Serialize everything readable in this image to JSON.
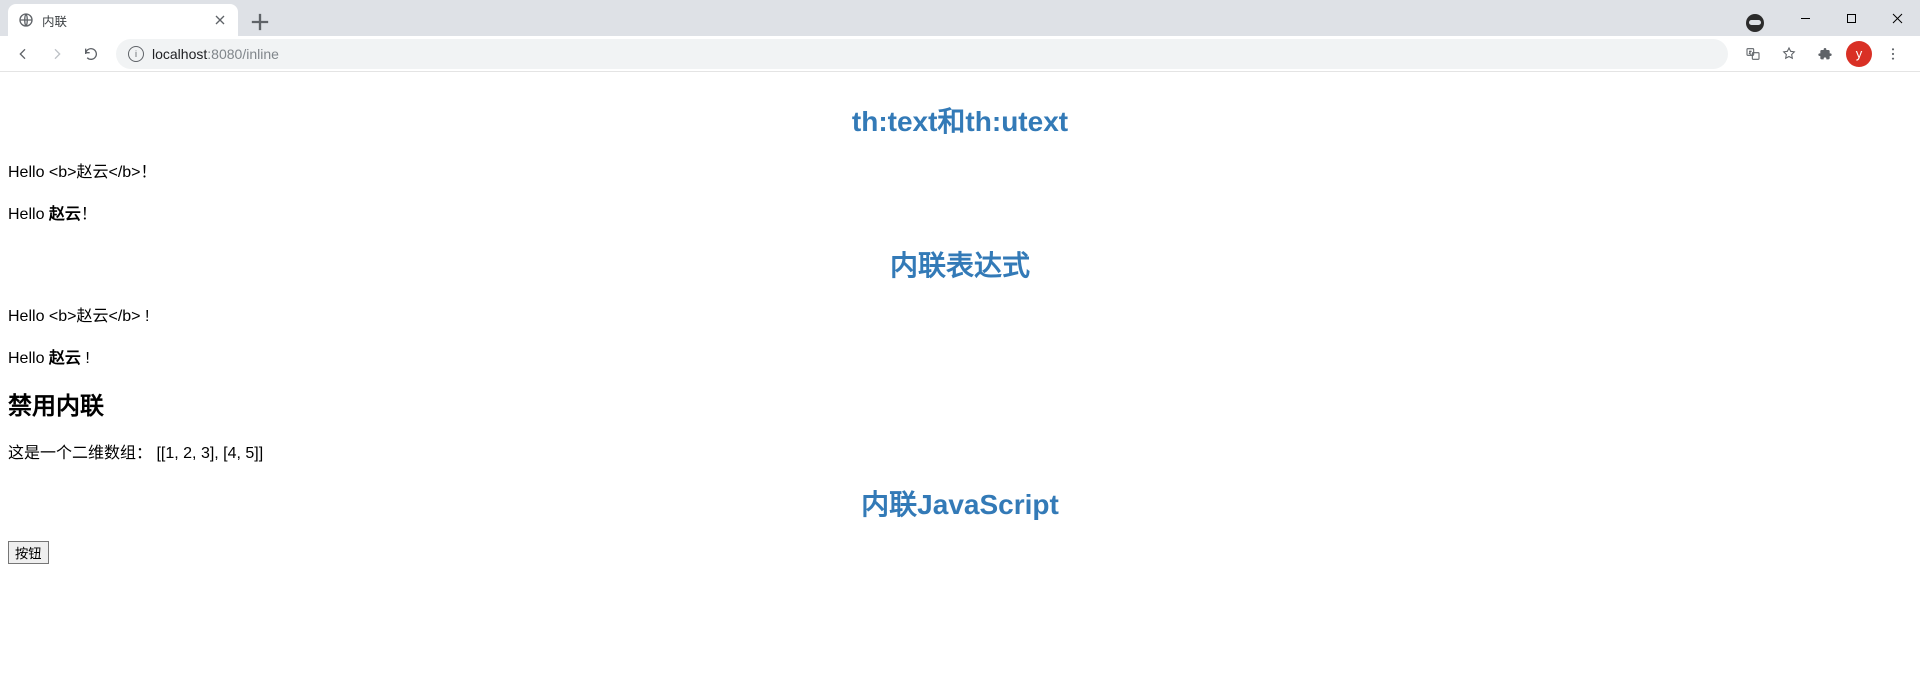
{
  "browser": {
    "tab_title": "内联",
    "url_host": "localhost",
    "url_port": ":8080",
    "url_path": "/inline",
    "avatar_letter": "y"
  },
  "headings": {
    "h_thtext": "th:text和th:utext",
    "h_inline_expr": "内联表达式",
    "h_disable_inline": "禁用内联",
    "h_inline_js": "内联JavaScript"
  },
  "lines": {
    "hello_prefix": "Hello ",
    "escaped_name_literal": "<b>赵云</b>",
    "unescaped_name_bold": "赵云",
    "bang_full": "！",
    "bang_half": " !",
    "array_label": "这是一个二维数组：",
    "array_value": "[[1, 2, 3], [4, 5]]"
  },
  "button": {
    "label": "按钮"
  }
}
